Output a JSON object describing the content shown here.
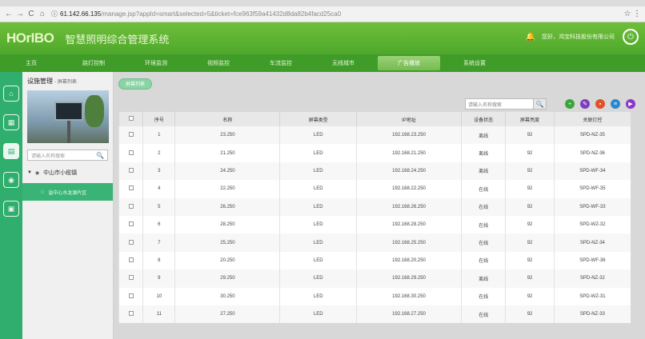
{
  "browser": {
    "url_host": "61.142.66.135",
    "url_rest": "/manage.jsp?appId=smart&selected=5&ticket=fce963f59a41432d8da82b4facd25ca0"
  },
  "header": {
    "logo": "HOrIBO",
    "system_title": "智慧照明综合管理系统",
    "greeting": "您好，鸿宝科技股份有限公司"
  },
  "nav": {
    "items": [
      {
        "label": "主页"
      },
      {
        "label": "路灯控制"
      },
      {
        "label": "环境监测"
      },
      {
        "label": "视频监控"
      },
      {
        "label": "车流监控"
      },
      {
        "label": "无线城市"
      },
      {
        "label": "广告播放"
      },
      {
        "label": "系统设置"
      }
    ],
    "active_index": 6
  },
  "side": {
    "title": "设施管理",
    "subtitle": "- 屏幕列表",
    "search_placeholder": "请输入名称搜索",
    "tree_root": "中山市小榄镇",
    "tree_child": "溢中心水龙源片区"
  },
  "main": {
    "tab_label": "屏幕列表",
    "search_placeholder": "请输入名称搜索",
    "columns": [
      "序号",
      "名称",
      "屏幕类型",
      "IP地址",
      "设备状态",
      "屏幕亮度",
      "关联灯控"
    ],
    "rows": [
      [
        "1",
        "23.250",
        "LED",
        "192.168.23.250",
        "离线",
        "92",
        "SPD-NZ-35"
      ],
      [
        "2",
        "21.250",
        "LED",
        "192.168.21.250",
        "离线",
        "92",
        "SPD-NZ-36"
      ],
      [
        "3",
        "24.250",
        "LED",
        "192.168.24.250",
        "离线",
        "92",
        "SPD-WF-34"
      ],
      [
        "4",
        "22.250",
        "LED",
        "192.168.22.250",
        "在线",
        "92",
        "SPD-WF-35"
      ],
      [
        "5",
        "26.250",
        "LED",
        "192.168.26.250",
        "在线",
        "92",
        "SPD-WF-33"
      ],
      [
        "6",
        "28.250",
        "LED",
        "192.168.28.250",
        "在线",
        "92",
        "SPD-WZ-32"
      ],
      [
        "7",
        "25.250",
        "LED",
        "192.168.25.250",
        "在线",
        "92",
        "SPD-NZ-34"
      ],
      [
        "8",
        "20.250",
        "LED",
        "192.168.20.250",
        "在线",
        "92",
        "SPD-WF-36"
      ],
      [
        "9",
        "29.250",
        "LED",
        "192.168.29.250",
        "离线",
        "92",
        "SPD-NZ-32"
      ],
      [
        "10",
        "30.250",
        "LED",
        "192.168.30.250",
        "在线",
        "92",
        "SPD-WZ-31"
      ],
      [
        "11",
        "27.250",
        "LED",
        "192.168.27.250",
        "在线",
        "92",
        "SPD-NZ-33"
      ]
    ]
  },
  "colors": {
    "brand_green": "#4ea82b",
    "rail_green": "#2fae6e",
    "toolbar_icons": [
      "#3aa53a",
      "#7a3fc0",
      "#e0522a",
      "#2a88d0",
      "#8a35c8"
    ]
  }
}
